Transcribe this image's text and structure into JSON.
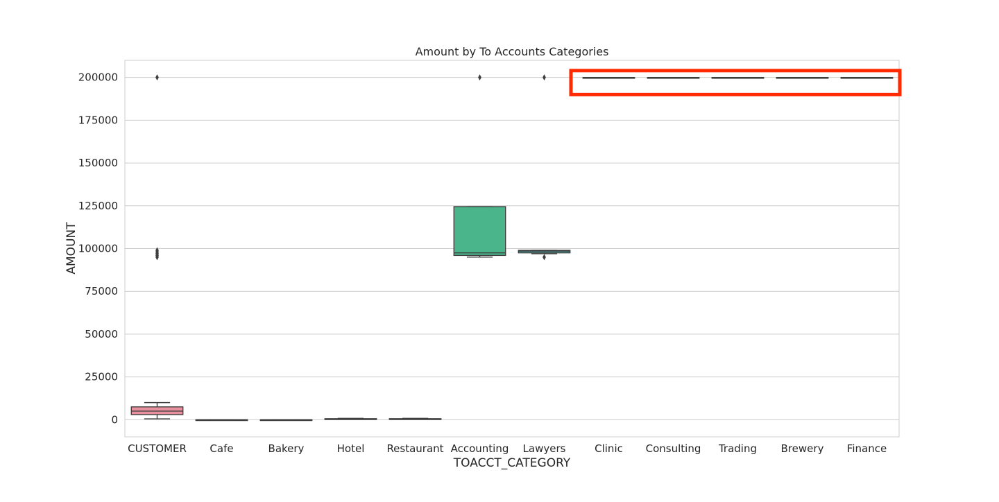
{
  "chart_data": {
    "type": "box",
    "title": "Amount by To Accounts Categories",
    "xlabel": "TOACCT_CATEGORY",
    "ylabel": "AMOUNT",
    "ylim": [
      -10000,
      210000
    ],
    "yticks": [
      0,
      25000,
      50000,
      75000,
      100000,
      125000,
      150000,
      175000,
      200000
    ],
    "ytick_labels": [
      "0",
      "25000",
      "50000",
      "75000",
      "100000",
      "125000",
      "150000",
      "175000",
      "200000"
    ],
    "grid": "horizontal",
    "categories": [
      "CUSTOMER",
      "Cafe",
      "Bakery",
      "Hotel",
      "Restaurant",
      "Accounting",
      "Lawyers",
      "Clinic",
      "Consulting",
      "Trading",
      "Brewery",
      "Finance"
    ],
    "boxes": [
      {
        "category": "CUSTOMER",
        "whisker_low": 500,
        "q1": 3000,
        "median": 5000,
        "q3": 7500,
        "whisker_high": 10000,
        "outliers": [
          95000,
          96000,
          97000,
          98000,
          99000,
          200000
        ],
        "color": "#e8909d"
      },
      {
        "category": "Cafe",
        "whisker_low": 0,
        "q1": 0,
        "median": 0,
        "q3": 0,
        "whisker_high": 0,
        "outliers": [],
        "color": "#e0955b"
      },
      {
        "category": "Bakery",
        "whisker_low": 0,
        "q1": 0,
        "median": 0,
        "q3": 0,
        "whisker_high": 0,
        "outliers": [],
        "color": "#c9a74e"
      },
      {
        "category": "Hotel",
        "whisker_low": 200,
        "q1": 300,
        "median": 400,
        "q3": 600,
        "whisker_high": 800,
        "outliers": [],
        "color": "#9fae4b"
      },
      {
        "category": "Restaurant",
        "whisker_low": 200,
        "q1": 300,
        "median": 400,
        "q3": 600,
        "whisker_high": 800,
        "outliers": [],
        "color": "#6fb04f"
      },
      {
        "category": "Accounting",
        "whisker_low": 95000,
        "q1": 96000,
        "median": 97500,
        "q3": 124500,
        "whisker_high": 124500,
        "outliers": [
          200000
        ],
        "color": "#4ab48a"
      },
      {
        "category": "Lawyers",
        "whisker_low": 97000,
        "q1": 97500,
        "median": 98500,
        "q3": 99000,
        "whisker_high": 99000,
        "outliers": [
          95000,
          200000
        ],
        "color": "#47b1a3"
      },
      {
        "category": "Clinic",
        "whisker_low": 200000,
        "q1": 200000,
        "median": 200000,
        "q3": 200000,
        "whisker_high": 200000,
        "outliers": [],
        "color": "#4aaec0"
      },
      {
        "category": "Consulting",
        "whisker_low": 200000,
        "q1": 200000,
        "median": 200000,
        "q3": 200000,
        "whisker_high": 200000,
        "outliers": [],
        "color": "#6fa3e0"
      },
      {
        "category": "Trading",
        "whisker_low": 200000,
        "q1": 200000,
        "median": 200000,
        "q3": 200000,
        "whisker_high": 200000,
        "outliers": [],
        "color": "#a892e8"
      },
      {
        "category": "Brewery",
        "whisker_low": 200000,
        "q1": 200000,
        "median": 200000,
        "q3": 200000,
        "whisker_high": 200000,
        "outliers": [],
        "color": "#dc86e0"
      },
      {
        "category": "Finance",
        "whisker_low": 200000,
        "q1": 200000,
        "median": 200000,
        "q3": 200000,
        "whisker_high": 200000,
        "outliers": [],
        "color": "#ec88bf"
      }
    ],
    "highlight": {
      "from_category": "Clinic",
      "to_category": "Finance",
      "color": "#ff2a00",
      "y_top": 204000,
      "y_bottom": 190000
    }
  }
}
